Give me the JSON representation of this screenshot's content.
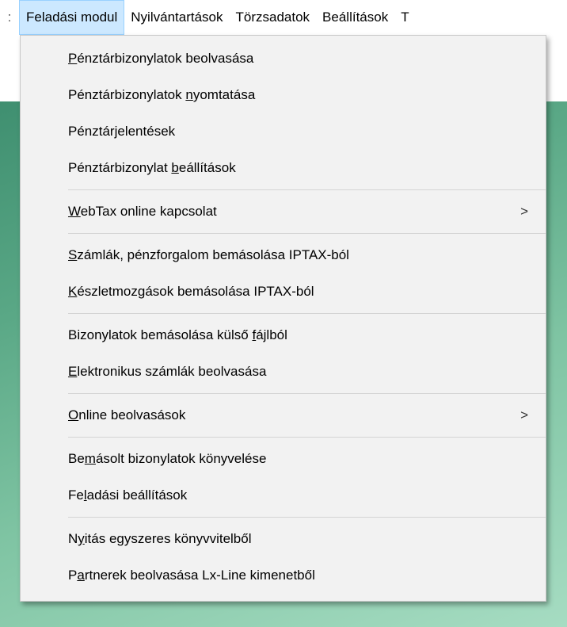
{
  "menubar": {
    "items": [
      {
        "label": "Feladási modul",
        "active": true
      },
      {
        "label": "Nyilvántartások"
      },
      {
        "label": "Törzsadatok"
      },
      {
        "label": "Beállítások"
      }
    ],
    "left_sep": ":",
    "right_cut": "T"
  },
  "dropdown": {
    "items": [
      {
        "pre": "",
        "acc": "P",
        "post": "énztárbizonylatok beolvasása"
      },
      {
        "pre": "Pénztárbizonylatok ",
        "acc": "n",
        "post": "yomtatása"
      },
      {
        "pre": "Pénztár",
        "acc": "j",
        "post": "elentések"
      },
      {
        "pre": "Pénztárbizonylat ",
        "acc": "b",
        "post": "eállítások"
      },
      {
        "pre": "",
        "acc": "W",
        "post": "ebTax online kapcsolat",
        "submenu": true
      },
      {
        "pre": "",
        "acc": "S",
        "post": "zámlák, pénzforgalom bemásolása IPTAX-ból"
      },
      {
        "pre": "",
        "acc": "K",
        "post": "észletmozgások bemásolása IPTAX-ból"
      },
      {
        "pre": "Bizonylatok bemásolása külső ",
        "acc": "f",
        "post": "ájlból"
      },
      {
        "pre": "",
        "acc": "E",
        "post": "lektronikus számlák beolvasása"
      },
      {
        "pre": "",
        "acc": "O",
        "post": "nline beolvasások",
        "submenu": true
      },
      {
        "pre": "Be",
        "acc": "m",
        "post": "ásolt bizonylatok könyvelése"
      },
      {
        "pre": "Fe",
        "acc": "l",
        "post": "adási beállítások"
      },
      {
        "pre": "N",
        "acc": "y",
        "post": "itás egyszeres könyvvitelből"
      },
      {
        "pre": "P",
        "acc": "a",
        "post": "rtnerek beolvasása Lx-Line kimenetből"
      }
    ],
    "arrow_glyph": ">"
  },
  "colors": {
    "menu_bg": "#f2f2f2",
    "highlight_bg": "#cce8ff",
    "highlight_border": "#99d1ff",
    "desktop_green": "#5aa886"
  }
}
